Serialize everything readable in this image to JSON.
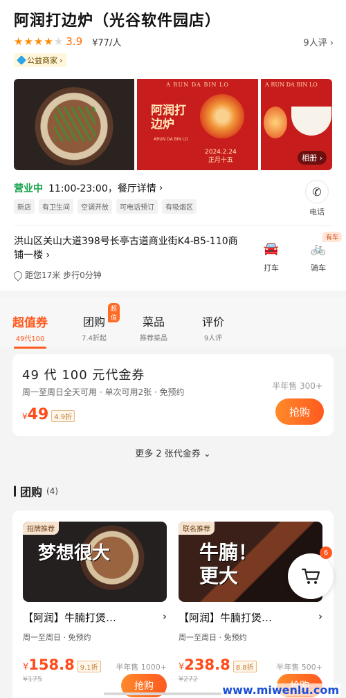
{
  "header": {
    "title": "阿润打边炉（光谷软件园店）",
    "stars_filled": 4,
    "stars_total": 5,
    "score": "3.9",
    "price_per_person": "¥77/人",
    "review_count": "9人评",
    "public_badge": "公益商家"
  },
  "photos": {
    "poster_head": "A RUN DA BIN LO",
    "poster_logo": "阿润打边炉",
    "poster_logo_sub": "ARUN DA BIN LO",
    "poster_date": "2024.2.24",
    "poster_festival": "正月十五",
    "album_label": "相册"
  },
  "info": {
    "status": "营业中",
    "hours": "11:00-23:00，餐厅详情",
    "tags": [
      "新店",
      "有卫生间",
      "空调开放",
      "可电话预订",
      "有吸烟区"
    ],
    "phone_label": "电话"
  },
  "location": {
    "address": "洪山区关山大道398号长亭古道商业街K4-B5-110商铺一楼",
    "distance": "距您17米 步行0分钟",
    "taxi_label": "打车",
    "bike_label": "骑车",
    "bike_badge": "有车"
  },
  "tabs": [
    {
      "label": "超值券",
      "sub": "49代100",
      "active": true
    },
    {
      "label": "团购",
      "sub": "7.4折起",
      "badge": "超值"
    },
    {
      "label": "菜品",
      "sub": "推荐菜品"
    },
    {
      "label": "评价",
      "sub": "9人评"
    }
  ],
  "voucher": {
    "title": "49 代 100 元代金券",
    "desc": "周一至周日全天可用 · 单次可用2张 · 免预约",
    "currency": "¥",
    "price": "49",
    "discount": "4.9折",
    "sold": "半年售 300+",
    "buy_label": "抢购"
  },
  "more_vouchers": "更多 2 张代金券",
  "group": {
    "title": "团购",
    "count": "(4)",
    "items": [
      {
        "tag": "招牌推荐",
        "img_text": "梦想很大",
        "name": "【阿润】牛腩打煲…",
        "meta": "周一至周日 · 免预约",
        "currency": "¥",
        "price": "158.8",
        "discount": "9.1折",
        "sold": "半年售 1000+",
        "original": "¥175",
        "buy_label": "抢购"
      },
      {
        "tag": "联名推荐",
        "img_text": "牛腩！更大",
        "name": "【阿润】牛腩打煲…",
        "meta": "周一至周日 · 免预约",
        "currency": "¥",
        "price": "238.8",
        "discount": "8.8折",
        "sold": "半年售 500+",
        "original": "¥272",
        "buy_label": "抢购"
      }
    ]
  },
  "cart_count": "6",
  "watermark": "www.miwenlu.com"
}
